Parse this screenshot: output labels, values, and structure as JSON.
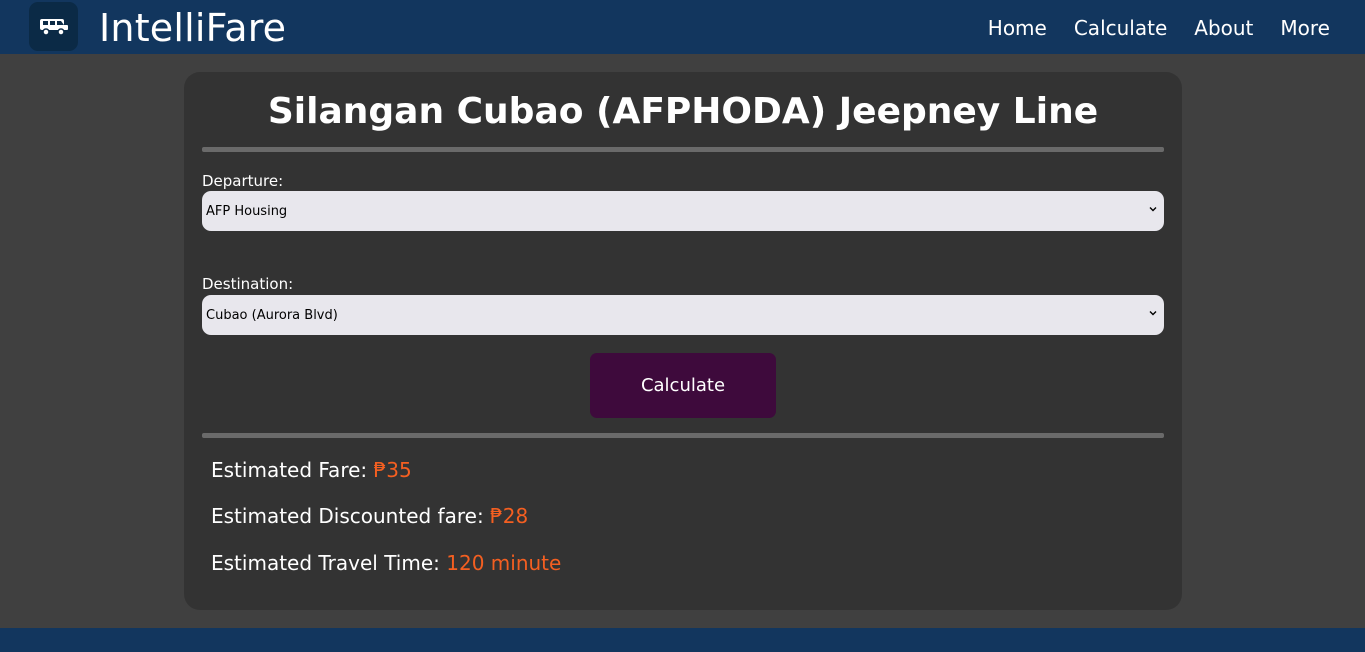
{
  "navbar": {
    "brand": "IntelliFare",
    "logo_icon": "jeepney-icon",
    "links": [
      "Home",
      "Calculate",
      "About",
      "More"
    ]
  },
  "route": {
    "title": "Silangan Cubao (AFPHODA) Jeepney Line"
  },
  "form": {
    "departure_label": "Departure:",
    "departure_value": "AFP Housing",
    "destination_label": "Destination:",
    "destination_value": "Cubao (Aurora Blvd)",
    "calculate_label": "Calculate"
  },
  "results": {
    "fare_label": "Estimated Fare:",
    "fare_value": "₱35",
    "discount_label": "Estimated Discounted fare:",
    "discount_value": "₱28",
    "time_label": "Estimated Travel Time:",
    "time_value": "120 minute"
  },
  "colors": {
    "navbar": "#12365e",
    "background": "#404040",
    "card": "#333333",
    "button": "#3e0a3c",
    "accent": "#f45f21"
  }
}
